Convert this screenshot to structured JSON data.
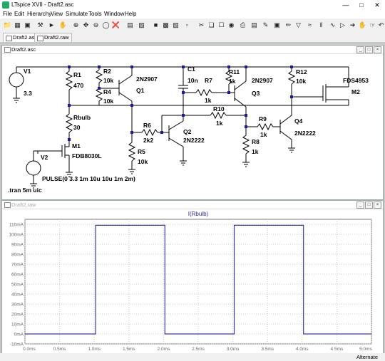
{
  "window": {
    "title": "LTspice XVII - Draft2.asc"
  },
  "menu": [
    "File",
    "Edit",
    "Hierarchy",
    "View",
    "Simulate",
    "Tools",
    "Window",
    "Help"
  ],
  "toolbar_icons": [
    "open-folder-icon",
    "new-schematic-icon",
    "save-icon",
    "control-panel-icon",
    "run-icon",
    "halt-icon",
    "zoom-in-icon",
    "pan-icon",
    "zoom-out-icon",
    "zoom-fit-icon",
    "autorange-icon",
    "tile-vertical-icon",
    "tile-horizontal-icon",
    "cascade-icon",
    "close-window-icon",
    "cut-icon",
    "copy-icon",
    "paste-icon",
    "find-icon",
    "print-icon",
    "print-preview-icon",
    "undo-icon",
    "redo-icon",
    "text-icon",
    "spice-directive-icon",
    "wire-icon",
    "ground-icon",
    "label-net-icon",
    "resistor-icon",
    "capacitor-icon",
    "inductor-icon",
    "diode-icon",
    "component-icon",
    "move-icon",
    "drag-icon",
    "undo2-icon",
    "redo2-icon"
  ],
  "tabs": [
    {
      "label": "Draft2.asc",
      "active": true
    },
    {
      "label": "Draft2.raw",
      "active": false
    }
  ],
  "schematic": {
    "title": "Draft2.asc",
    "labels": {
      "v1": "V1",
      "v1_val": "3.3",
      "r1": "R1",
      "r1_val": "470",
      "r2": "R2",
      "r2_val": "10k",
      "r4": "R4",
      "r4_val": "10k",
      "q1_type": "2N2907",
      "q1": "Q1",
      "c1": "C1",
      "c1_val": "10n",
      "r7": "R7",
      "r7_val": "1k",
      "r11": "R11",
      "r11_val": "1k",
      "q3_type": "2N2907",
      "q3": "Q3",
      "r12": "R12",
      "r12_val": "10k",
      "m2_type": "FDS4953",
      "m2": "M2",
      "rbulb": "Rbulb",
      "rbulb_val": "30",
      "r10": "R10",
      "r10_val": "1k",
      "r9": "R9",
      "r9_val": "1k",
      "q4": "Q4",
      "q4_type": "2N2222",
      "r6": "R6",
      "r6_val": "2k2",
      "q2": "Q2",
      "q2_type": "2N2222",
      "r8": "R8",
      "r8_val": "1k",
      "r5": "R5",
      "r5_val": "10k",
      "m1": "M1",
      "m1_type": "FDB8030L",
      "v2": "V2",
      "v2_val": "PULSE(0 3.3 1m 10u 10u 1m 2m)",
      "tran": ".tran 5m uic"
    }
  },
  "waveform_window": {
    "title": "Draft2.raw"
  },
  "chart_data": {
    "type": "line",
    "title": "I(Rbulb)",
    "xlabel": "",
    "ylabel": "",
    "x_ticks": [
      "0.0ms",
      "0.5ms",
      "1.0ms",
      "1.5ms",
      "2.0ms",
      "2.5ms",
      "3.0ms",
      "3.5ms",
      "4.0ms",
      "4.5ms",
      "5.0ms"
    ],
    "y_ticks": [
      "-10mA",
      "0mA",
      "10mA",
      "20mA",
      "30mA",
      "40mA",
      "50mA",
      "60mA",
      "70mA",
      "80mA",
      "90mA",
      "100mA",
      "110mA"
    ],
    "xlim": [
      0,
      5
    ],
    "ylim": [
      -10,
      115
    ],
    "grid": true,
    "series": [
      {
        "name": "I(Rbulb)",
        "color": "#3b3ba8",
        "x": [
          0,
          1.02,
          1.02,
          2.02,
          2.02,
          3.02,
          3.02,
          4.02,
          4.02,
          5.0
        ],
        "y": [
          0,
          0,
          109,
          109,
          0,
          0,
          109,
          109,
          0,
          0
        ]
      }
    ]
  },
  "status": {
    "text": "Alternate"
  }
}
